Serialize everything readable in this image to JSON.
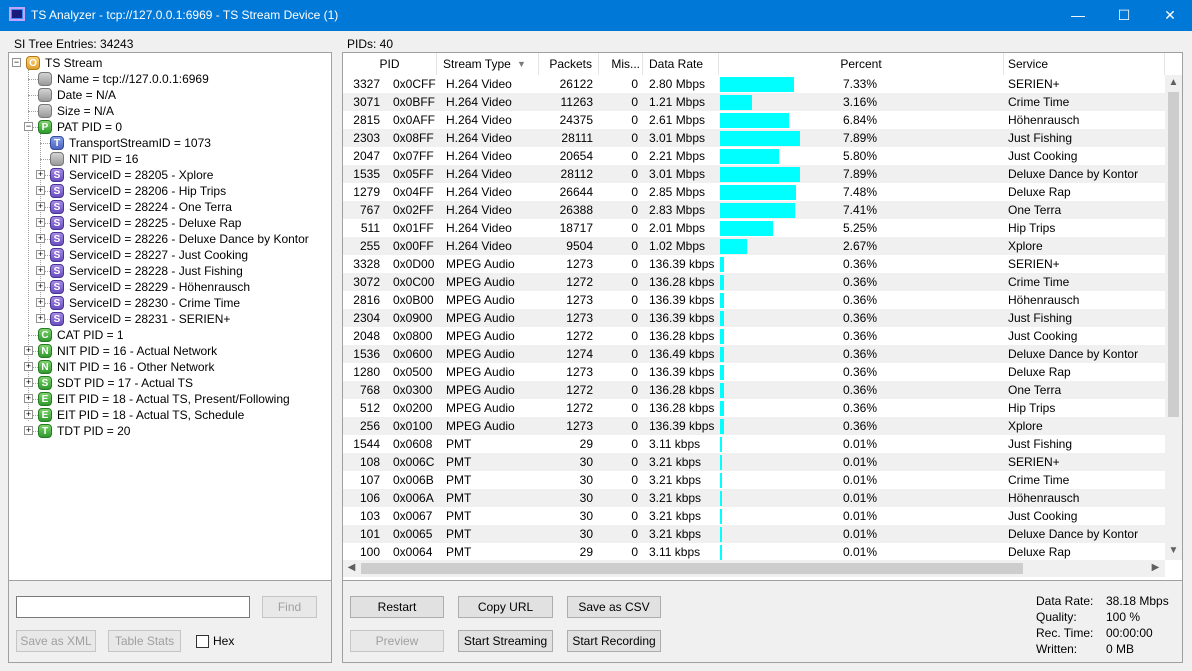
{
  "window": {
    "title": "TS Analyzer - tcp://127.0.0.1:6969 - TS Stream Device (1)",
    "min_glyph": "—",
    "max_glyph": "☐",
    "close_glyph": "✕",
    "accent": "#0078d7"
  },
  "left": {
    "label": "SI Tree Entries: 34243",
    "tree": [
      {
        "text": "TS Stream",
        "icon": "O",
        "color": "orange",
        "exp": "-"
      },
      {
        "text": "Name = tcp://127.0.0.1:6969",
        "icon": "",
        "color": "gray",
        "exp": ""
      },
      {
        "text": "Date = N/A",
        "icon": "",
        "color": "gray",
        "exp": ""
      },
      {
        "text": "Size = N/A",
        "icon": "",
        "color": "gray",
        "exp": ""
      },
      {
        "text": "PAT PID = 0",
        "icon": "P",
        "color": "green",
        "exp": "-"
      },
      {
        "text": "TransportStreamID = 1073",
        "icon": "T",
        "color": "blue",
        "exp": ""
      },
      {
        "text": "NIT PID = 16",
        "icon": "",
        "color": "gray",
        "exp": ""
      },
      {
        "text": "ServiceID = 28205 - Xplore",
        "icon": "S",
        "color": "purple",
        "exp": "+"
      },
      {
        "text": "ServiceID = 28206 - Hip Trips",
        "icon": "S",
        "color": "purple",
        "exp": "+"
      },
      {
        "text": "ServiceID = 28224 - One Terra",
        "icon": "S",
        "color": "purple",
        "exp": "+"
      },
      {
        "text": "ServiceID = 28225 - Deluxe Rap",
        "icon": "S",
        "color": "purple",
        "exp": "+"
      },
      {
        "text": "ServiceID = 28226 - Deluxe Dance by Kontor",
        "icon": "S",
        "color": "purple",
        "exp": "+"
      },
      {
        "text": "ServiceID = 28227 - Just Cooking",
        "icon": "S",
        "color": "purple",
        "exp": "+"
      },
      {
        "text": "ServiceID = 28228 - Just Fishing",
        "icon": "S",
        "color": "purple",
        "exp": "+"
      },
      {
        "text": "ServiceID = 28229 - Höhenrausch",
        "icon": "S",
        "color": "purple",
        "exp": "+"
      },
      {
        "text": "ServiceID = 28230 - Crime Time",
        "icon": "S",
        "color": "purple",
        "exp": "+"
      },
      {
        "text": "ServiceID = 28231 - SERIEN+",
        "icon": "S",
        "color": "purple",
        "exp": "+"
      },
      {
        "text": "CAT PID = 1",
        "icon": "C",
        "color": "green",
        "exp": ""
      },
      {
        "text": "NIT PID = 16 - Actual Network",
        "icon": "N",
        "color": "green",
        "exp": "+"
      },
      {
        "text": "NIT PID = 16 - Other Network",
        "icon": "N",
        "color": "green",
        "exp": "+"
      },
      {
        "text": "SDT PID = 17 - Actual TS",
        "icon": "S",
        "color": "green",
        "exp": "+"
      },
      {
        "text": "EIT PID = 18 - Actual TS, Present/Following",
        "icon": "E",
        "color": "green",
        "exp": "+"
      },
      {
        "text": "EIT PID = 18 - Actual TS, Schedule",
        "icon": "E",
        "color": "green",
        "exp": "+"
      },
      {
        "text": "TDT PID = 20",
        "icon": "T",
        "color": "green",
        "exp": "+"
      }
    ],
    "search_value": "",
    "find_label": "Find",
    "save_xml_label": "Save as XML",
    "table_stats_label": "Table Stats",
    "hex_label": "Hex"
  },
  "right": {
    "label": "PIDs: 40",
    "columns": [
      "PID",
      "Stream Type",
      "Packets",
      "Mis...",
      "Data Rate",
      "Percent",
      "Service"
    ],
    "rows": [
      {
        "pid": "3327",
        "hex": "0x0CFF",
        "type": "H.264 Video",
        "packets": "26122",
        "missing": "0",
        "rate": "2.80 Mbps",
        "percent": "7.33%",
        "pct": 7.33,
        "service": "SERIEN+"
      },
      {
        "pid": "3071",
        "hex": "0x0BFF",
        "type": "H.264 Video",
        "packets": "11263",
        "missing": "0",
        "rate": "1.21 Mbps",
        "percent": "3.16%",
        "pct": 3.16,
        "service": "Crime Time"
      },
      {
        "pid": "2815",
        "hex": "0x0AFF",
        "type": "H.264 Video",
        "packets": "24375",
        "missing": "0",
        "rate": "2.61 Mbps",
        "percent": "6.84%",
        "pct": 6.84,
        "service": "Höhenrausch"
      },
      {
        "pid": "2303",
        "hex": "0x08FF",
        "type": "H.264 Video",
        "packets": "28111",
        "missing": "0",
        "rate": "3.01 Mbps",
        "percent": "7.89%",
        "pct": 7.89,
        "service": "Just Fishing"
      },
      {
        "pid": "2047",
        "hex": "0x07FF",
        "type": "H.264 Video",
        "packets": "20654",
        "missing": "0",
        "rate": "2.21 Mbps",
        "percent": "5.80%",
        "pct": 5.8,
        "service": "Just Cooking"
      },
      {
        "pid": "1535",
        "hex": "0x05FF",
        "type": "H.264 Video",
        "packets": "28112",
        "missing": "0",
        "rate": "3.01 Mbps",
        "percent": "7.89%",
        "pct": 7.89,
        "service": "Deluxe Dance by Kontor"
      },
      {
        "pid": "1279",
        "hex": "0x04FF",
        "type": "H.264 Video",
        "packets": "26644",
        "missing": "0",
        "rate": "2.85 Mbps",
        "percent": "7.48%",
        "pct": 7.48,
        "service": "Deluxe Rap"
      },
      {
        "pid": "767",
        "hex": "0x02FF",
        "type": "H.264 Video",
        "packets": "26388",
        "missing": "0",
        "rate": "2.83 Mbps",
        "percent": "7.41%",
        "pct": 7.41,
        "service": "One Terra"
      },
      {
        "pid": "511",
        "hex": "0x01FF",
        "type": "H.264 Video",
        "packets": "18717",
        "missing": "0",
        "rate": "2.01 Mbps",
        "percent": "5.25%",
        "pct": 5.25,
        "service": "Hip Trips"
      },
      {
        "pid": "255",
        "hex": "0x00FF",
        "type": "H.264 Video",
        "packets": "9504",
        "missing": "0",
        "rate": "1.02 Mbps",
        "percent": "2.67%",
        "pct": 2.67,
        "service": "Xplore"
      },
      {
        "pid": "3328",
        "hex": "0x0D00",
        "type": "MPEG Audio",
        "packets": "1273",
        "missing": "0",
        "rate": "136.39 kbps",
        "percent": "0.36%",
        "pct": 0.36,
        "service": "SERIEN+"
      },
      {
        "pid": "3072",
        "hex": "0x0C00",
        "type": "MPEG Audio",
        "packets": "1272",
        "missing": "0",
        "rate": "136.28 kbps",
        "percent": "0.36%",
        "pct": 0.36,
        "service": "Crime Time"
      },
      {
        "pid": "2816",
        "hex": "0x0B00",
        "type": "MPEG Audio",
        "packets": "1273",
        "missing": "0",
        "rate": "136.39 kbps",
        "percent": "0.36%",
        "pct": 0.36,
        "service": "Höhenrausch"
      },
      {
        "pid": "2304",
        "hex": "0x0900",
        "type": "MPEG Audio",
        "packets": "1273",
        "missing": "0",
        "rate": "136.39 kbps",
        "percent": "0.36%",
        "pct": 0.36,
        "service": "Just Fishing"
      },
      {
        "pid": "2048",
        "hex": "0x0800",
        "type": "MPEG Audio",
        "packets": "1272",
        "missing": "0",
        "rate": "136.28 kbps",
        "percent": "0.36%",
        "pct": 0.36,
        "service": "Just Cooking"
      },
      {
        "pid": "1536",
        "hex": "0x0600",
        "type": "MPEG Audio",
        "packets": "1274",
        "missing": "0",
        "rate": "136.49 kbps",
        "percent": "0.36%",
        "pct": 0.36,
        "service": "Deluxe Dance by Kontor"
      },
      {
        "pid": "1280",
        "hex": "0x0500",
        "type": "MPEG Audio",
        "packets": "1273",
        "missing": "0",
        "rate": "136.39 kbps",
        "percent": "0.36%",
        "pct": 0.36,
        "service": "Deluxe Rap"
      },
      {
        "pid": "768",
        "hex": "0x0300",
        "type": "MPEG Audio",
        "packets": "1272",
        "missing": "0",
        "rate": "136.28 kbps",
        "percent": "0.36%",
        "pct": 0.36,
        "service": "One Terra"
      },
      {
        "pid": "512",
        "hex": "0x0200",
        "type": "MPEG Audio",
        "packets": "1272",
        "missing": "0",
        "rate": "136.28 kbps",
        "percent": "0.36%",
        "pct": 0.36,
        "service": "Hip Trips"
      },
      {
        "pid": "256",
        "hex": "0x0100",
        "type": "MPEG Audio",
        "packets": "1273",
        "missing": "0",
        "rate": "136.39 kbps",
        "percent": "0.36%",
        "pct": 0.36,
        "service": "Xplore"
      },
      {
        "pid": "1544",
        "hex": "0x0608",
        "type": "PMT",
        "packets": "29",
        "missing": "0",
        "rate": "3.11 kbps",
        "percent": "0.01%",
        "pct": 0.01,
        "service": "Just Fishing"
      },
      {
        "pid": "108",
        "hex": "0x006C",
        "type": "PMT",
        "packets": "30",
        "missing": "0",
        "rate": "3.21 kbps",
        "percent": "0.01%",
        "pct": 0.01,
        "service": "SERIEN+"
      },
      {
        "pid": "107",
        "hex": "0x006B",
        "type": "PMT",
        "packets": "30",
        "missing": "0",
        "rate": "3.21 kbps",
        "percent": "0.01%",
        "pct": 0.01,
        "service": "Crime Time"
      },
      {
        "pid": "106",
        "hex": "0x006A",
        "type": "PMT",
        "packets": "30",
        "missing": "0",
        "rate": "3.21 kbps",
        "percent": "0.01%",
        "pct": 0.01,
        "service": "Höhenrausch"
      },
      {
        "pid": "103",
        "hex": "0x0067",
        "type": "PMT",
        "packets": "30",
        "missing": "0",
        "rate": "3.21 kbps",
        "percent": "0.01%",
        "pct": 0.01,
        "service": "Just Cooking"
      },
      {
        "pid": "101",
        "hex": "0x0065",
        "type": "PMT",
        "packets": "30",
        "missing": "0",
        "rate": "3.21 kbps",
        "percent": "0.01%",
        "pct": 0.01,
        "service": "Deluxe Dance by Kontor"
      },
      {
        "pid": "100",
        "hex": "0x0064",
        "type": "PMT",
        "packets": "29",
        "missing": "0",
        "rate": "3.11 kbps",
        "percent": "0.01%",
        "pct": 0.01,
        "service": "Deluxe Rap"
      }
    ],
    "bar_color": "#00ffff",
    "restart_label": "Restart",
    "copy_url_label": "Copy URL",
    "save_csv_label": "Save as CSV",
    "preview_label": "Preview",
    "start_streaming_label": "Start Streaming",
    "start_recording_label": "Start Recording",
    "stats": [
      {
        "label": "Data Rate:",
        "value": "38.18 Mbps"
      },
      {
        "label": "Quality:",
        "value": "100 %"
      },
      {
        "label": "Rec. Time:",
        "value": "00:00:00"
      },
      {
        "label": "Written:",
        "value": "0 MB"
      }
    ]
  }
}
